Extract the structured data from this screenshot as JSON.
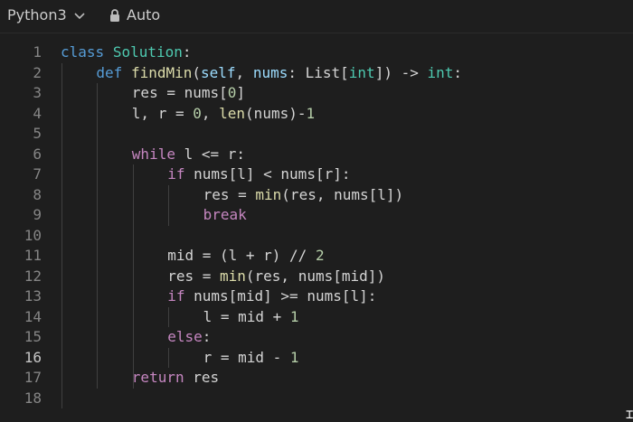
{
  "toolbar": {
    "language": "Python3",
    "mode": "Auto"
  },
  "editor": {
    "active_line": 16,
    "lines": [
      {
        "n": "1",
        "indent": 0,
        "tokens": [
          [
            "kw2",
            "class"
          ],
          [
            "id",
            " "
          ],
          [
            "ty",
            "Solution"
          ],
          [
            "id",
            ":"
          ]
        ]
      },
      {
        "n": "2",
        "indent": 1,
        "tokens": [
          [
            "kw2",
            "def"
          ],
          [
            "id",
            " "
          ],
          [
            "fn",
            "findMin"
          ],
          [
            "id",
            "("
          ],
          [
            "param",
            "self"
          ],
          [
            "id",
            ", "
          ],
          [
            "param",
            "nums"
          ],
          [
            "id",
            ": "
          ],
          [
            "id",
            "List["
          ],
          [
            "ty",
            "int"
          ],
          [
            "id",
            "]) -> "
          ],
          [
            "ty",
            "int"
          ],
          [
            "id",
            ":"
          ]
        ]
      },
      {
        "n": "3",
        "indent": 2,
        "tokens": [
          [
            "id",
            "res = nums["
          ],
          [
            "num",
            "0"
          ],
          [
            "id",
            "]"
          ]
        ]
      },
      {
        "n": "4",
        "indent": 2,
        "tokens": [
          [
            "id",
            "l, r = "
          ],
          [
            "num",
            "0"
          ],
          [
            "id",
            ", "
          ],
          [
            "fn",
            "len"
          ],
          [
            "id",
            "(nums)-"
          ],
          [
            "num",
            "1"
          ]
        ]
      },
      {
        "n": "5",
        "indent": 0,
        "tokens": []
      },
      {
        "n": "6",
        "indent": 2,
        "tokens": [
          [
            "kw",
            "while"
          ],
          [
            "id",
            " l <= r:"
          ]
        ]
      },
      {
        "n": "7",
        "indent": 3,
        "tokens": [
          [
            "kw",
            "if"
          ],
          [
            "id",
            " nums[l] < nums[r]:"
          ]
        ]
      },
      {
        "n": "8",
        "indent": 4,
        "tokens": [
          [
            "id",
            "res = "
          ],
          [
            "fn",
            "min"
          ],
          [
            "id",
            "(res, nums[l])"
          ]
        ]
      },
      {
        "n": "9",
        "indent": 4,
        "tokens": [
          [
            "kw",
            "break"
          ]
        ]
      },
      {
        "n": "10",
        "indent": 0,
        "tokens": []
      },
      {
        "n": "11",
        "indent": 3,
        "tokens": [
          [
            "id",
            "mid = (l + r) // "
          ],
          [
            "num",
            "2"
          ]
        ]
      },
      {
        "n": "12",
        "indent": 3,
        "tokens": [
          [
            "id",
            "res = "
          ],
          [
            "fn",
            "min"
          ],
          [
            "id",
            "(res, nums[mid])"
          ]
        ]
      },
      {
        "n": "13",
        "indent": 3,
        "tokens": [
          [
            "kw",
            "if"
          ],
          [
            "id",
            " nums[mid] >= nums[l]:"
          ]
        ]
      },
      {
        "n": "14",
        "indent": 4,
        "tokens": [
          [
            "id",
            "l = mid + "
          ],
          [
            "num",
            "1"
          ]
        ]
      },
      {
        "n": "15",
        "indent": 3,
        "tokens": [
          [
            "kw",
            "else"
          ],
          [
            "id",
            ":"
          ]
        ]
      },
      {
        "n": "16",
        "indent": 4,
        "tokens": [
          [
            "id",
            "r = mid - "
          ],
          [
            "num",
            "1"
          ]
        ]
      },
      {
        "n": "17",
        "indent": 2,
        "tokens": [
          [
            "kw",
            "return"
          ],
          [
            "id",
            " res"
          ]
        ]
      },
      {
        "n": "18",
        "indent": 0,
        "tokens": []
      }
    ]
  },
  "colors": {
    "background": "#1e1e1e",
    "keyword_control": "#c586c0",
    "keyword_decl": "#569cd6",
    "type": "#4ec9b0",
    "function": "#dcdcaa",
    "number": "#b5cea8",
    "parameter": "#9cdcfe"
  }
}
